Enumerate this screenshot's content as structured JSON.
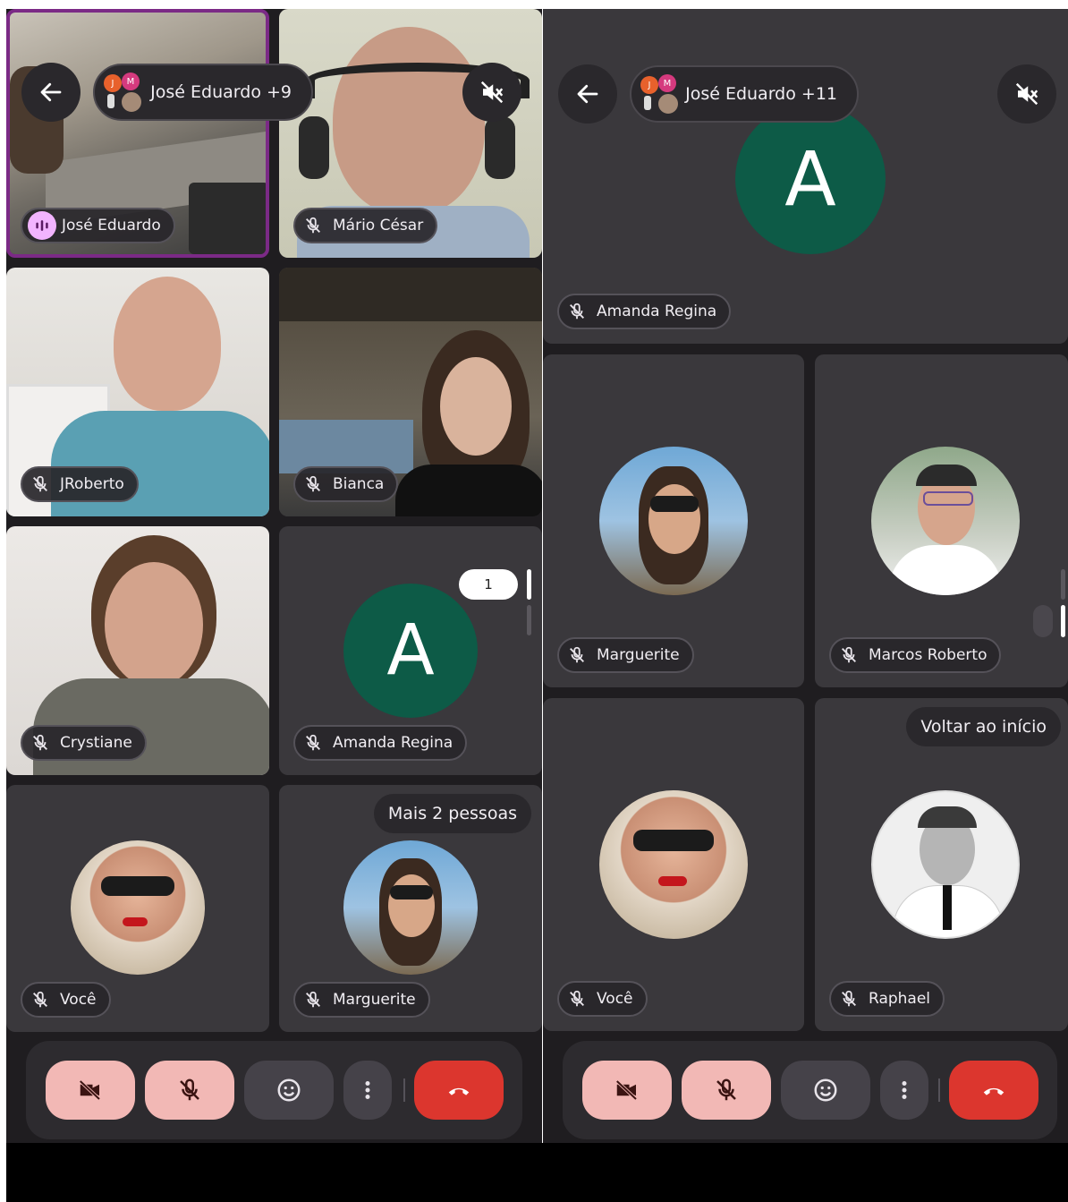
{
  "left": {
    "header": {
      "pill_label": "José Eduardo +9",
      "mini_avatar_letters": [
        "J",
        "M"
      ]
    },
    "tiles": [
      {
        "name": "José Eduardo",
        "mic": "speaking"
      },
      {
        "name": "Mário César",
        "mic": "off"
      },
      {
        "name": "JRoberto",
        "mic": "off"
      },
      {
        "name": "Bianca",
        "mic": "off"
      },
      {
        "name": "Crystiane",
        "mic": "off"
      },
      {
        "name": "Amanda Regina",
        "mic": "off",
        "avatar_letter": "A"
      },
      {
        "name": "Você",
        "mic": "off"
      },
      {
        "name": "Marguerite",
        "mic": "off"
      }
    ],
    "more_people_label": "Mais 2 pessoas",
    "unread_badge": "1"
  },
  "right": {
    "header": {
      "pill_label": "José Eduardo +11",
      "mini_avatar_letters": [
        "J",
        "M"
      ]
    },
    "tiles": [
      {
        "name": "Amanda Regina",
        "mic": "off",
        "avatar_letter": "A"
      },
      {
        "name": "Marguerite",
        "mic": "off"
      },
      {
        "name": "Marcos Roberto",
        "mic": "off"
      },
      {
        "name": "Você",
        "mic": "off"
      },
      {
        "name": "Raphael",
        "mic": "off"
      }
    ],
    "back_to_start_label": "Voltar ao início"
  },
  "colors": {
    "screen_bg": "#1f1d20",
    "tile_bg": "#3c3a3e",
    "avatar_green": "#0d5b47",
    "speaking_border": "#7b2a86",
    "control_pink": "#f2b8b5",
    "hangup_red": "#dc362e"
  },
  "icons": {
    "back": "arrow-left-icon",
    "speaker": "speaker-muted-icon",
    "camera": "camera-off-icon",
    "mic": "mic-off-icon",
    "emoji": "emoji-icon",
    "more": "more-vert-icon",
    "hangup": "call-end-icon"
  }
}
